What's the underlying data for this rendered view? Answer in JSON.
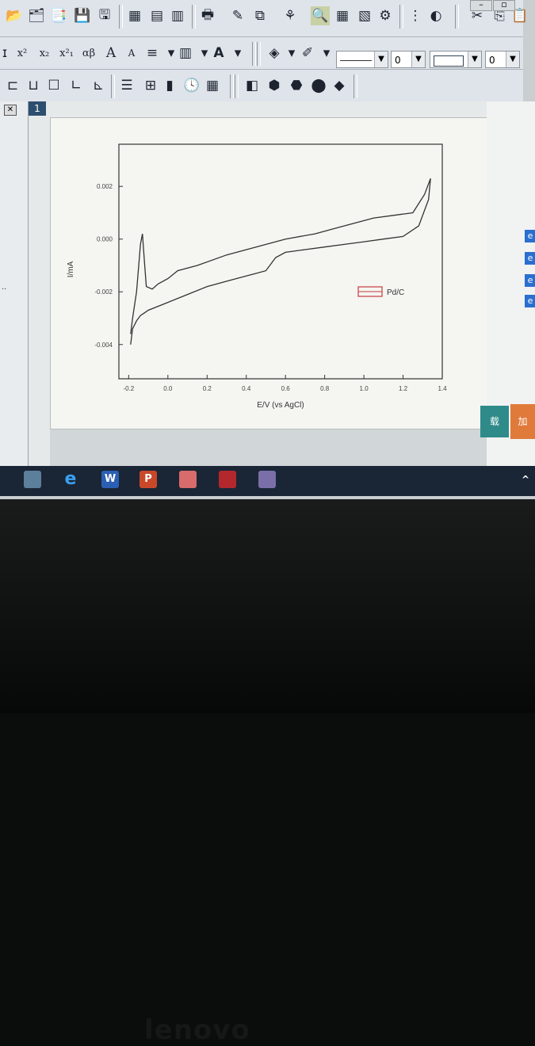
{
  "toolbar": {
    "format_labels": [
      "x²",
      "x₂",
      "x²₁",
      "αβ",
      "A",
      "A"
    ],
    "combo_line_value": "",
    "combo_width_1": "0",
    "combo_width_2": "0",
    "window_min": "–",
    "window_max": "▫"
  },
  "graph_window": {
    "tab_number": "1",
    "close_glyph": "✕"
  },
  "right_panel": {
    "teal_button_text": "载",
    "orange_button_text": "加"
  },
  "taskbar": {
    "apps": [
      "",
      "e",
      "W",
      "P",
      "",
      "",
      ""
    ]
  },
  "laptop_brand": "lenovo",
  "chart_data": {
    "type": "line",
    "xlabel": "E/V (vs AgCl)",
    "ylabel": "I/mA",
    "xlim": [
      -0.25,
      1.4
    ],
    "ylim": [
      -0.0053,
      0.0036
    ],
    "x_ticks": [
      -0.2,
      0.0,
      0.2,
      0.4,
      0.6,
      0.8,
      1.0,
      1.2,
      1.4
    ],
    "x_tick_labels": [
      "-0.2",
      "0.0",
      "0.2",
      "0.4",
      "0.6",
      "0.8",
      "1.0",
      "1.2",
      "1.4"
    ],
    "y_ticks": [
      0.002,
      0.0,
      -0.002,
      -0.004
    ],
    "y_tick_labels": [
      "0.002",
      "0.000",
      "-0.002",
      "-0.004"
    ],
    "legend": "right",
    "grid": false,
    "series": [
      {
        "name": "Pd/C",
        "color": "#333333",
        "x": [
          -0.19,
          -0.18,
          -0.16,
          -0.14,
          -0.12,
          -0.1,
          0.0,
          0.1,
          0.2,
          0.3,
          0.4,
          0.45,
          0.5,
          0.55,
          0.6,
          0.7,
          0.8,
          0.9,
          1.0,
          1.1,
          1.2,
          1.28,
          1.33,
          1.34,
          1.31,
          1.25,
          1.15,
          1.05,
          0.95,
          0.85,
          0.75,
          0.6,
          0.45,
          0.3,
          0.15,
          0.05,
          0.0,
          -0.05,
          -0.08,
          -0.11,
          -0.12,
          -0.13,
          -0.14,
          -0.16,
          -0.18,
          -0.19
        ],
        "y": [
          -0.004,
          -0.0034,
          -0.0031,
          -0.0029,
          -0.0028,
          -0.0027,
          -0.0024,
          -0.0021,
          -0.0018,
          -0.0016,
          -0.0014,
          -0.0013,
          -0.0012,
          -0.0007,
          -0.0005,
          -0.0004,
          -0.0003,
          -0.0002,
          -0.0001,
          0.0,
          0.0001,
          0.0005,
          0.0015,
          0.0023,
          0.0017,
          0.001,
          0.0009,
          0.0008,
          0.0006,
          0.0004,
          0.0002,
          0.0,
          -0.0003,
          -0.0006,
          -0.001,
          -0.0012,
          -0.0015,
          -0.0017,
          -0.0019,
          -0.0018,
          -0.0008,
          0.0002,
          -0.0002,
          -0.002,
          -0.003,
          -0.0036
        ]
      }
    ]
  }
}
